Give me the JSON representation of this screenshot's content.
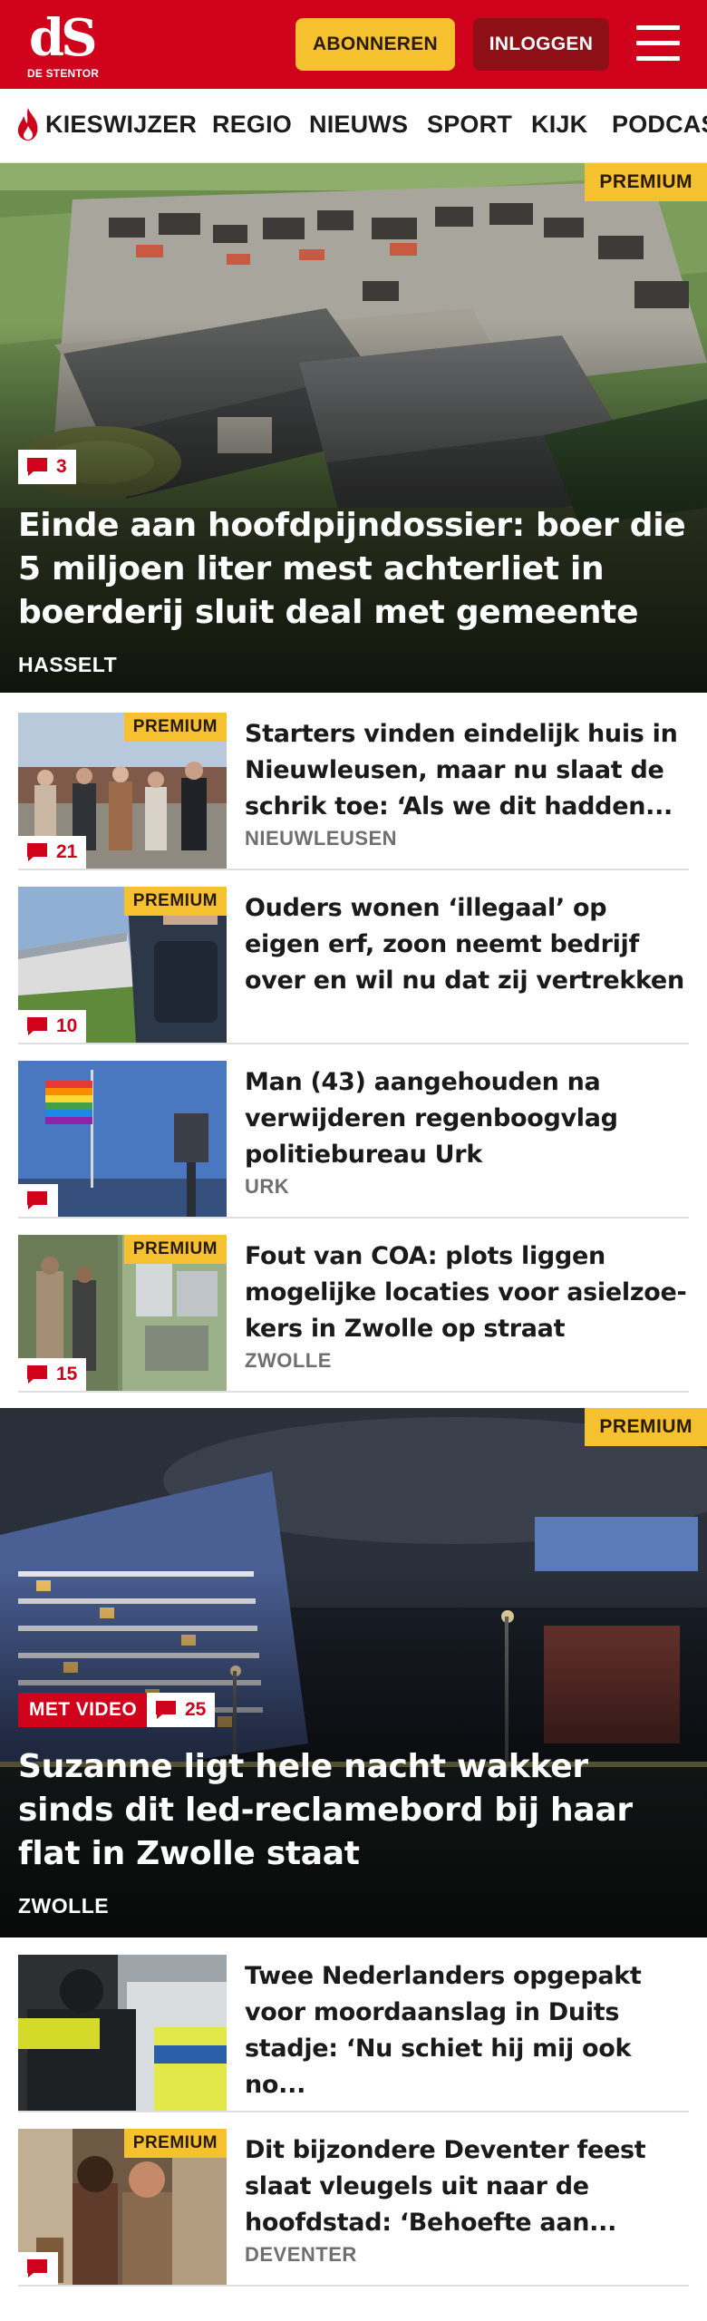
{
  "header": {
    "logo_mark": "dS",
    "logo_sub": "DE STENTOR",
    "subscribe_label": "ABONNEREN",
    "login_label": "INLOGGEN"
  },
  "nav": {
    "items": [
      "KIESWIJZER",
      "REGIO",
      "NIEUWS",
      "SPORT",
      "KIJK",
      "PODCAS"
    ]
  },
  "hero1": {
    "premium": "PREMIUM",
    "comments": "3",
    "title": "Einde aan hoofdpijndossier: boer die 5 miljoen liter mest achterliet in boerderij sluit deal met gemeente",
    "location": "HASSELT"
  },
  "articles": [
    {
      "premium": "PREMIUM",
      "comments": "21",
      "title": "Starters vinden eindelijk huis in Nieuwleusen, maar nu slaat de schrik toe: ‘Als we dit hadden...",
      "location": "NIEUWLEUSEN"
    },
    {
      "premium": "PREMIUM",
      "comments": "10",
      "title": "Ouders wonen ‘illegaal’ op eigen erf, zoon neemt bedrijf over en wil nu dat zij vertrekken",
      "location": ""
    },
    {
      "premium": "",
      "comments": "",
      "title": "Man (43) aangehouden na verwijderen regenboogvlag politiebureau Urk",
      "location": "URK"
    },
    {
      "premium": "PREMIUM",
      "comments": "15",
      "title": "Fout van COA: plots liggen mogelijke locaties voor asielzoe-kers in Zwolle op straat",
      "location": "ZWOLLE"
    }
  ],
  "hero2": {
    "premium": "PREMIUM",
    "video_label": "MET VIDEO",
    "comments": "25",
    "title": "Suzanne ligt hele nacht wakker sinds dit led-reclamebord bij haar flat in Zwolle staat",
    "location": "ZWOLLE"
  },
  "articles2": [
    {
      "premium": "",
      "comments": "",
      "title": "Twee Nederlanders opgepakt voor moordaanslag in Duits stadje: ‘Nu schiet hij mij ook no...",
      "location": ""
    },
    {
      "premium": "PREMIUM",
      "comments": "",
      "title": "Dit bijzondere Deventer feest slaat vleugels uit naar de hoofdstad: ‘Behoefte aan...",
      "location": "DEVENTER"
    }
  ],
  "colors": {
    "brand_red": "#d0021b",
    "premium_yellow": "#f6c12f",
    "login_dark_red": "#8e0f16"
  },
  "icons": {
    "menu": "hamburger-menu-icon",
    "trending": "flame-icon",
    "comments": "speech-bubble-icon"
  }
}
